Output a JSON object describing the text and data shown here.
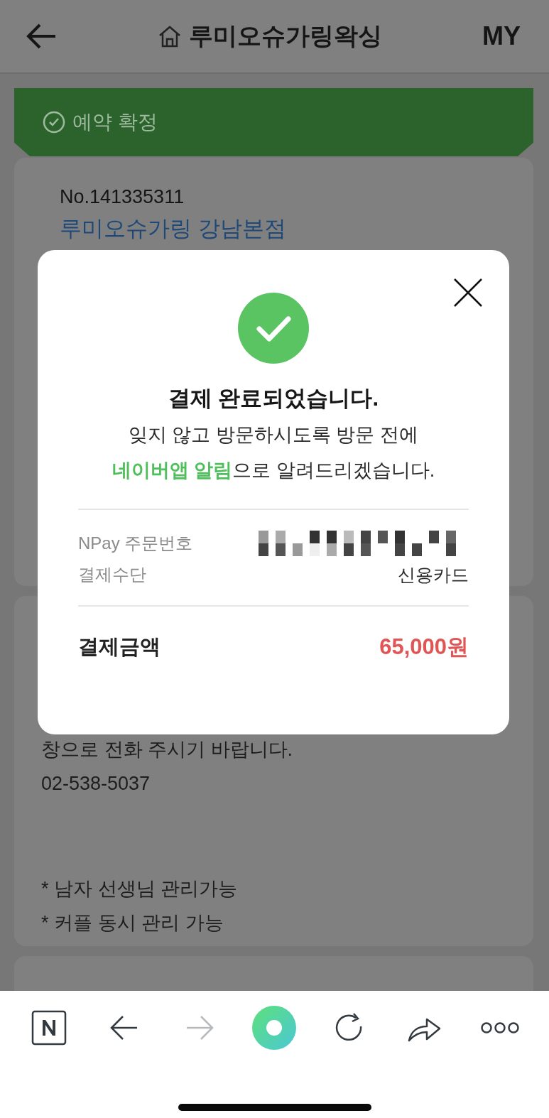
{
  "header": {
    "title": "루미오슈가링왁싱",
    "my": "MY"
  },
  "banner": {
    "label": "예약 확정"
  },
  "booking": {
    "number": "No.141335311",
    "shop": "루미오슈가링 강남본점"
  },
  "notice": {
    "groups": [
      [
        "창으로 전화 주시기 바랍니다.",
        "02-538-5037"
      ],
      [
        "* 남자 선생님 관리가능",
        "* 커플 동시 관리 가능"
      ]
    ]
  },
  "modal": {
    "title": "결제 완료되었습니다.",
    "message": [
      "잊지 않고 방문하시도록 방문 전에",
      "**네이버앱 알림**으로 알려드리겠습니다."
    ],
    "details": [
      {
        "label": "NPay 주문번호",
        "kind": "redacted"
      },
      {
        "label": "결제수단",
        "kind": "text",
        "value": "신용카드"
      }
    ],
    "total": {
      "label": "결제금액",
      "value": "65,000원"
    }
  },
  "toolbar": [
    {
      "kind": "naver",
      "disabled": false
    },
    {
      "kind": "back",
      "disabled": false
    },
    {
      "kind": "forward",
      "disabled": true
    },
    {
      "kind": "green-dot",
      "disabled": false
    },
    {
      "kind": "reload",
      "disabled": false
    },
    {
      "kind": "share",
      "disabled": false
    },
    {
      "kind": "more",
      "disabled": false
    }
  ]
}
